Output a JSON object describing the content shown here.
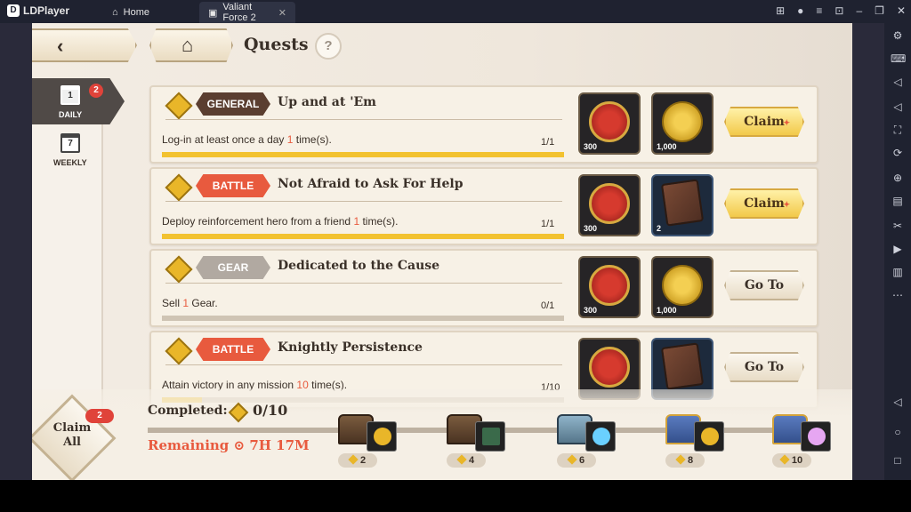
{
  "emulator": {
    "app_name": "LDPlayer",
    "tabs": [
      {
        "label": "Home"
      },
      {
        "label": "Valiant Force 2"
      }
    ]
  },
  "header": {
    "title": "Quests",
    "help": "?"
  },
  "period_tabs": {
    "daily": {
      "label": "DAILY",
      "day": "1",
      "badge": "2"
    },
    "weekly": {
      "label": "WEEKLY",
      "day": "7"
    }
  },
  "quests": [
    {
      "category": "GENERAL",
      "title": "Up and at 'Em",
      "desc_pre": "Log-in at least once a day ",
      "desc_num": "1",
      "desc_post": " time(s).",
      "progress": "1/1",
      "progress_fraction": 1.0,
      "rewards": [
        {
          "type": "crest",
          "qty": "300"
        },
        {
          "type": "coin",
          "qty": "1,000"
        }
      ],
      "action": "Claim"
    },
    {
      "category": "BATTLE",
      "title": "Not Afraid to Ask For Help",
      "desc_pre": "Deploy reinforcement hero from a friend ",
      "desc_num": "1",
      "desc_post": " time(s).",
      "progress": "1/1",
      "progress_fraction": 1.0,
      "rewards": [
        {
          "type": "crest",
          "qty": "300"
        },
        {
          "type": "tome",
          "qty": "2"
        }
      ],
      "action": "Claim"
    },
    {
      "category": "GEAR",
      "title": "Dedicated to the Cause",
      "desc_pre": "Sell ",
      "desc_num": "1",
      "desc_post": " Gear.",
      "progress": "0/1",
      "progress_fraction": 0.0,
      "rewards": [
        {
          "type": "crest",
          "qty": "300"
        },
        {
          "type": "coin",
          "qty": "1,000"
        }
      ],
      "action": "Go To"
    },
    {
      "category": "BATTLE",
      "title": "Knightly Persistence",
      "desc_pre": "Attain victory in any mission ",
      "desc_num": "10",
      "desc_post": " time(s).",
      "progress": "1/10",
      "progress_fraction": 0.1,
      "rewards": [
        {
          "type": "crest",
          "qty": ""
        },
        {
          "type": "tome",
          "qty": ""
        }
      ],
      "action": "Go To"
    }
  ],
  "footer": {
    "claim_all": "Claim All",
    "claim_all_badge": "2",
    "completed_label": "Completed:",
    "completed_count": "0/10",
    "remaining": "Remaining",
    "remaining_time": "7H 17M",
    "milestones": [
      "2",
      "4",
      "6",
      "8",
      "10"
    ]
  }
}
